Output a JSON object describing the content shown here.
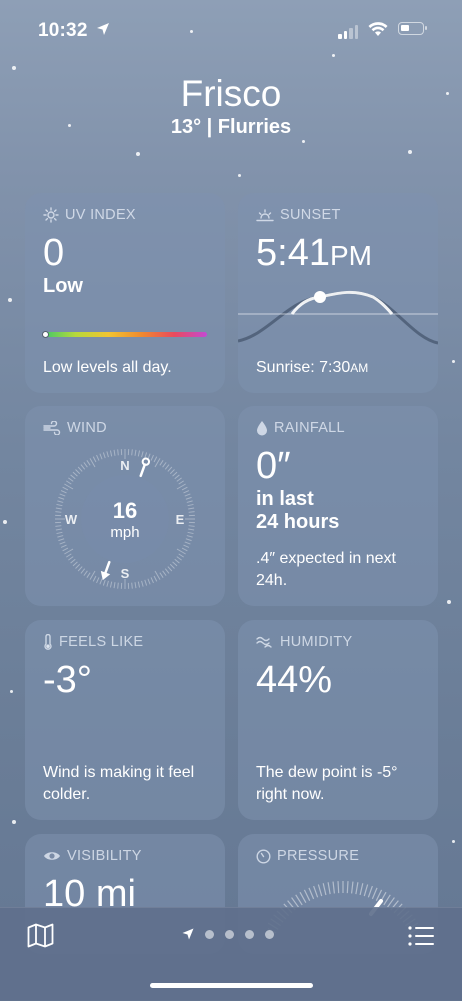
{
  "status": {
    "time": "10:32"
  },
  "header": {
    "city": "Frisco",
    "subline": "13° | Flurries"
  },
  "uv": {
    "title": "UV INDEX",
    "value": "0",
    "level": "Low",
    "desc": "Low levels all day.",
    "fraction": 0.0
  },
  "sunset": {
    "title": "SUNSET",
    "time": "5:41",
    "ampm": "PM",
    "sunrise_label": "Sunrise: 7:30",
    "sunrise_ampm": "AM"
  },
  "wind": {
    "title": "WIND",
    "speed": "16",
    "unit": "mph",
    "n": "N",
    "s": "S",
    "e": "E",
    "w": "W",
    "direction_deg": 20
  },
  "rainfall": {
    "title": "RAINFALL",
    "value": "0″",
    "period_line1": "in last",
    "period_line2": "24 hours",
    "desc": ".4″ expected in next 24h."
  },
  "feels_like": {
    "title": "FEELS LIKE",
    "value": "-3°",
    "desc": "Wind is making it feel colder."
  },
  "humidity": {
    "title": "HUMIDITY",
    "value": "44%",
    "desc": "The dew point is -5° right now."
  },
  "visibility": {
    "title": "VISIBILITY",
    "value": "10 mi"
  },
  "pressure": {
    "title": "PRESSURE"
  },
  "colors": {
    "uv_gradient": [
      "#3fc86a",
      "#b7d93b",
      "#f2c431",
      "#ef8a2e",
      "#e94a5e",
      "#c44ad3"
    ]
  },
  "tabbar": {
    "left_icon": "map-icon",
    "right_icon": "list-icon",
    "pages": 4
  }
}
